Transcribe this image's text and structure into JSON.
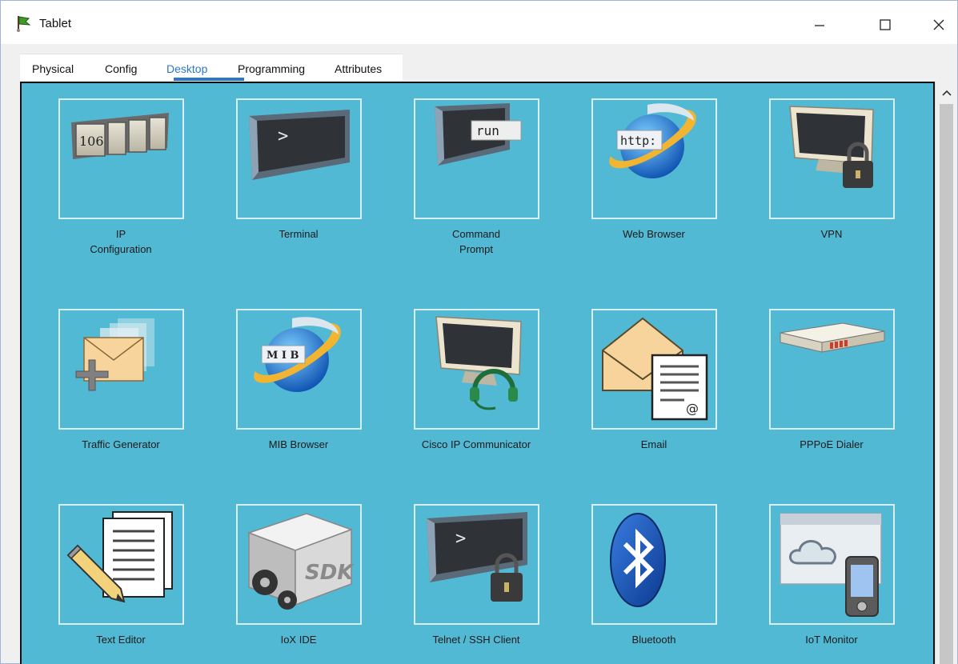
{
  "window": {
    "title": "Tablet"
  },
  "tabs": [
    {
      "label": "Physical"
    },
    {
      "label": "Config"
    },
    {
      "label": "Desktop"
    },
    {
      "label": "Programming"
    },
    {
      "label": "Attributes"
    }
  ],
  "active_tab": "Desktop",
  "apps": [
    {
      "label": "IP Configuration",
      "line1": "IP",
      "line2": "Configuration",
      "icon": "ip-configuration-icon",
      "icon_text": "106"
    },
    {
      "label": "Terminal",
      "line1": "Terminal",
      "line2": "",
      "icon": "terminal-icon",
      "icon_text": ">"
    },
    {
      "label": "Command Prompt",
      "line1": "Command",
      "line2": "Prompt",
      "icon": "command-prompt-icon",
      "icon_text": "run"
    },
    {
      "label": "Web Browser",
      "line1": "Web Browser",
      "line2": "",
      "icon": "web-browser-icon",
      "icon_text": "http:"
    },
    {
      "label": "VPN",
      "line1": "VPN",
      "line2": "",
      "icon": "vpn-icon"
    },
    {
      "label": "Traffic Generator",
      "line1": "Traffic Generator",
      "line2": "",
      "icon": "traffic-generator-icon"
    },
    {
      "label": "MIB Browser",
      "line1": "MIB Browser",
      "line2": "",
      "icon": "mib-browser-icon",
      "icon_text": "M I B"
    },
    {
      "label": "Cisco IP Communicator",
      "line1": "Cisco IP Communicator",
      "line2": "",
      "icon": "cisco-ip-communicator-icon"
    },
    {
      "label": "Email",
      "line1": "Email",
      "line2": "",
      "icon": "email-icon",
      "icon_text": "@"
    },
    {
      "label": "PPPoE Dialer",
      "line1": "PPPoE Dialer",
      "line2": "",
      "icon": "pppoe-dialer-icon"
    },
    {
      "label": "Text Editor",
      "line1": "Text Editor",
      "line2": "",
      "icon": "text-editor-icon"
    },
    {
      "label": "IoX IDE",
      "line1": "IoX IDE",
      "line2": "",
      "icon": "iox-ide-icon",
      "icon_text": "SDK"
    },
    {
      "label": "Telnet / SSH Client",
      "line1": "Telnet / SSH Client",
      "line2": "",
      "icon": "telnet-ssh-client-icon",
      "icon_text": ">"
    },
    {
      "label": "Bluetooth",
      "line1": "Bluetooth",
      "line2": "",
      "icon": "bluetooth-icon"
    },
    {
      "label": "IoT Monitor",
      "line1": "IoT Monitor",
      "line2": "",
      "icon": "iot-monitor-icon"
    }
  ],
  "colors": {
    "desktop_bg": "#52b9d4",
    "tile_border": "#d8eef5",
    "active_tab": "#2c78c8"
  }
}
